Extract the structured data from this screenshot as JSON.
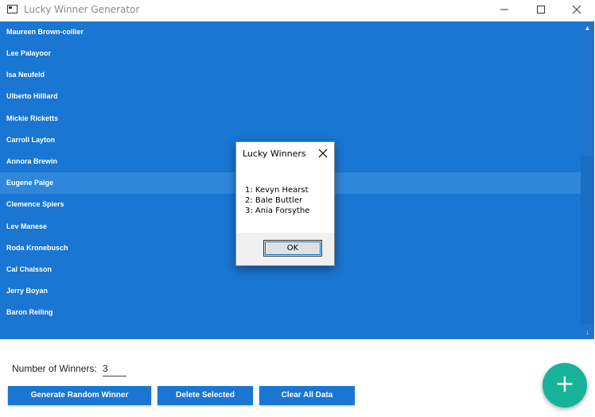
{
  "window": {
    "title": "Lucky Winner Generator",
    "icon": "window-icon"
  },
  "list": {
    "items": [
      {
        "name": "Maureen Brown-collier"
      },
      {
        "name": "Lee Palayoor"
      },
      {
        "name": "Isa Neufeld"
      },
      {
        "name": "Ulberto Hilliard"
      },
      {
        "name": "Mickie Ricketts"
      },
      {
        "name": "Carroll Layton"
      },
      {
        "name": "Annora Brewin"
      },
      {
        "name": "Eugene Paige"
      },
      {
        "name": "Clemence Spiers"
      },
      {
        "name": "Lev Manese"
      },
      {
        "name": "Roda Kronebusch"
      },
      {
        "name": "Cal Chaisson"
      },
      {
        "name": "Jerry Boyan"
      },
      {
        "name": "Baron Reiling"
      }
    ],
    "highlighted_item": "Eugene Paige"
  },
  "controls": {
    "winners_label": "Number of Winners:",
    "winners_value": "3",
    "generate_label": "Generate Random Winner",
    "delete_label": "Delete Selected",
    "clear_label": "Clear All Data",
    "fab_icon": "plus-icon"
  },
  "dialog": {
    "title": "Lucky Winners",
    "lines": [
      "1: Kevyn Hearst",
      "2: Bale Buttler",
      "3: Ania Forsythe"
    ],
    "ok_label": "OK"
  },
  "colors": {
    "list_background": "#1976d2",
    "highlight": "#2f87db",
    "button": "#1976d2",
    "fab": "#16b39a"
  }
}
